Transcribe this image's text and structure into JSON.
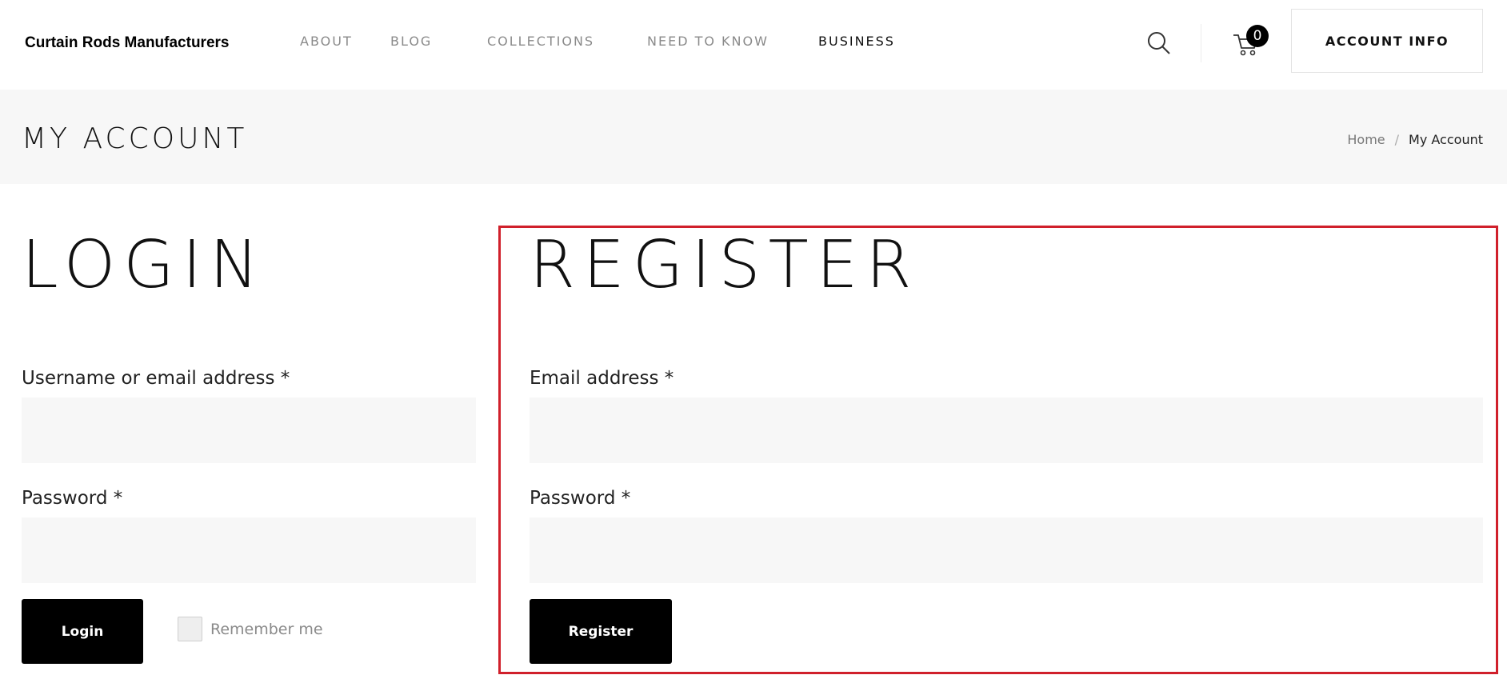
{
  "header": {
    "logo": "Curtain Rods Manufacturers",
    "nav": [
      {
        "label": "ABOUT"
      },
      {
        "label": "BLOG"
      },
      {
        "label": "COLLECTIONS"
      },
      {
        "label": "NEED TO KNOW"
      },
      {
        "label": "BUSINESS"
      }
    ],
    "cart_count": "0",
    "account_button": "ACCOUNT INFO"
  },
  "title_band": {
    "title": "MY ACCOUNT",
    "breadcrumb": {
      "home": "Home",
      "separator": "/",
      "current": "My Account"
    }
  },
  "login": {
    "heading": "LOGIN",
    "username_label": "Username or email address *",
    "username_value": "",
    "password_label": "Password *",
    "password_value": "",
    "button": "Login",
    "remember_label": "Remember me",
    "remember_checked": false
  },
  "register": {
    "heading": "REGISTER",
    "email_label": "Email address *",
    "email_value": "",
    "password_label": "Password *",
    "password_value": "",
    "button": "Register"
  },
  "icons": {
    "search": "search-icon",
    "cart": "cart-icon"
  },
  "colors": {
    "highlight": "#d0202b",
    "button": "#000000",
    "band": "#f7f7f7"
  }
}
